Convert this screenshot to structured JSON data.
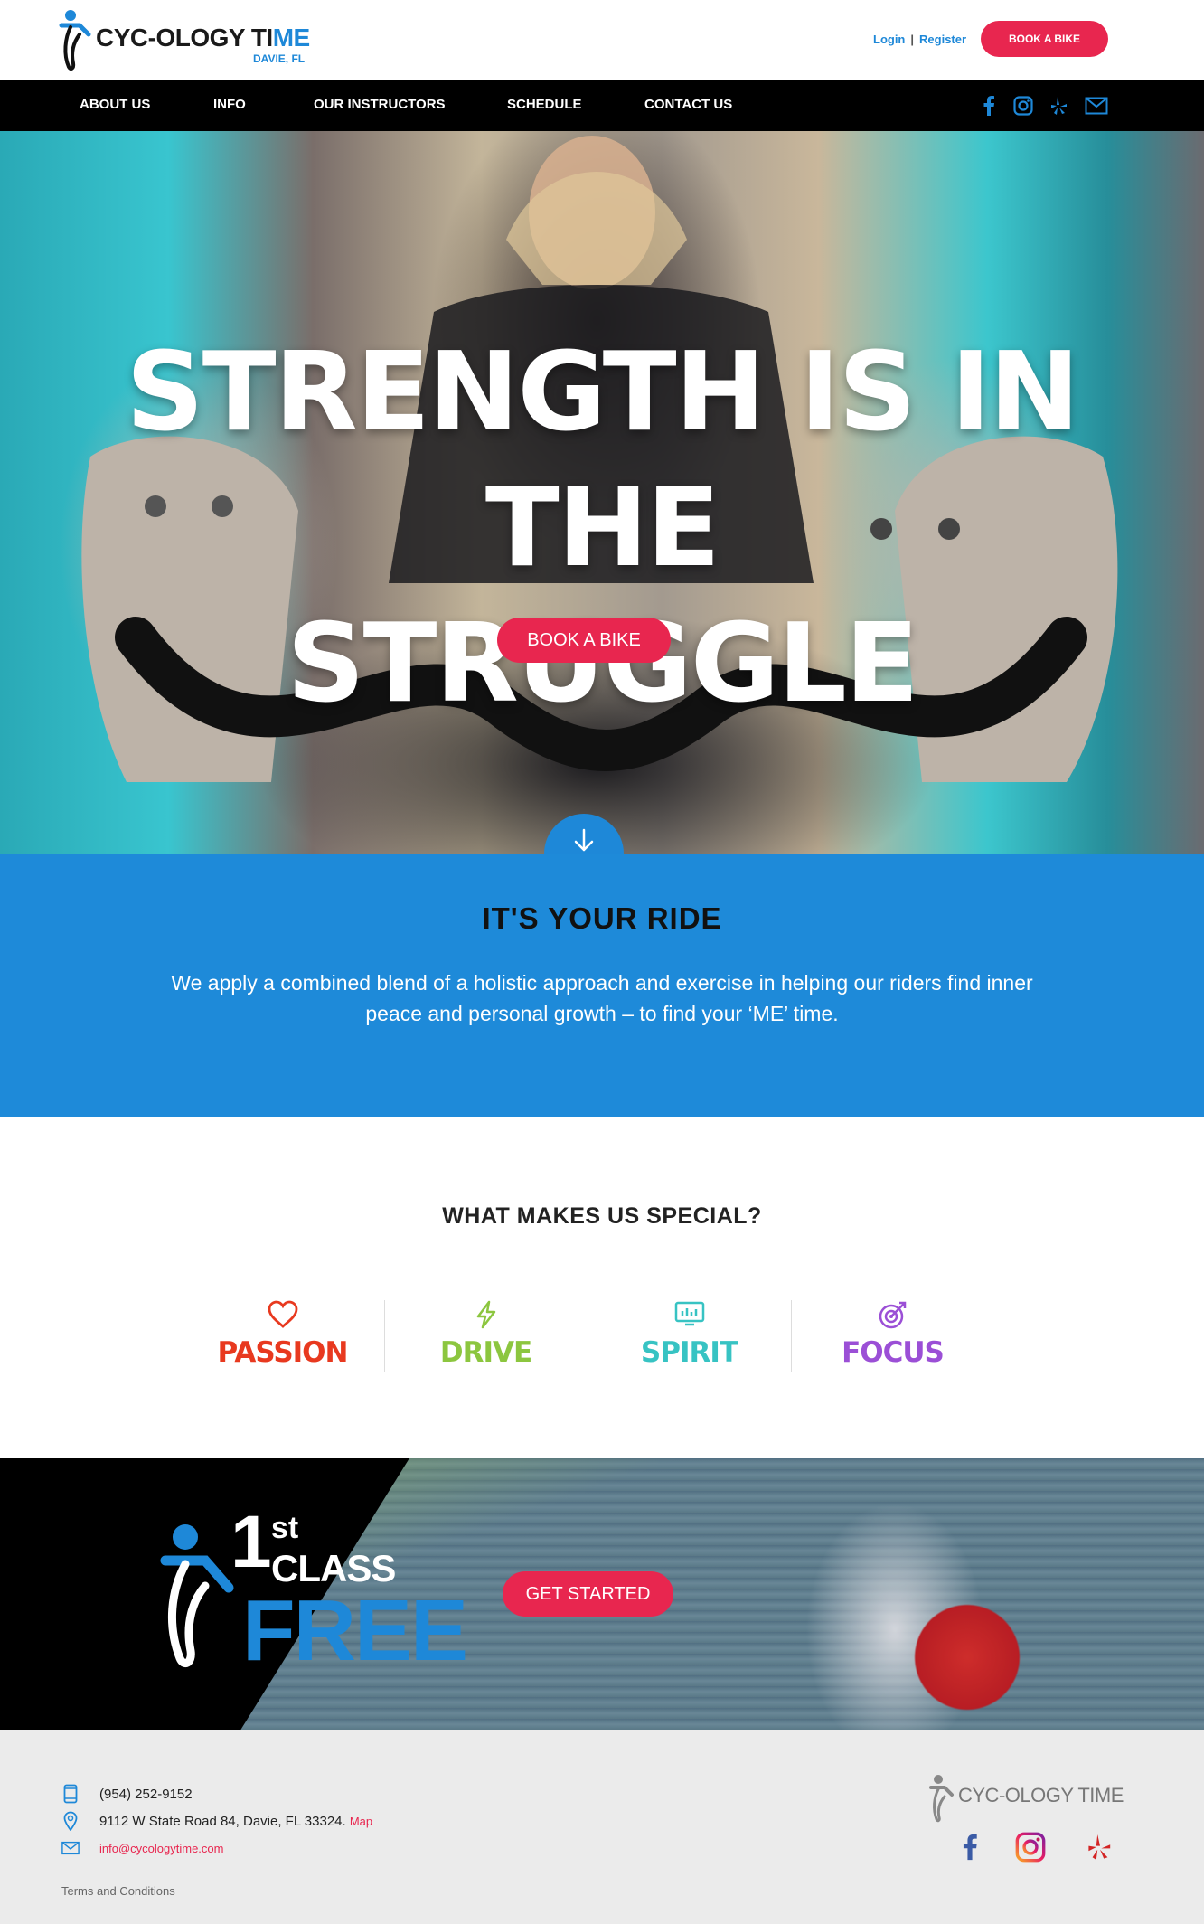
{
  "header": {
    "logo_text_main": "CYC-OLOGY TI",
    "logo_text_accent": "ME",
    "logo_subtitle": "DAVIE, FL",
    "login_label": "Login",
    "separator": "|",
    "register_label": "Register",
    "book_label": "BOOK A BIKE"
  },
  "nav": {
    "items": [
      "ABOUT US",
      "INFO",
      "OUR INSTRUCTORS",
      "SCHEDULE",
      "CONTACT US"
    ],
    "social_icons": [
      "facebook-icon",
      "instagram-icon",
      "yelp-icon",
      "mail-icon"
    ]
  },
  "hero": {
    "title_line1": "STRENGTH IS IN THE",
    "title_line2": "STRUGGLE",
    "button_label": "BOOK A BIKE"
  },
  "ride": {
    "heading": "IT'S YOUR RIDE",
    "body": "We apply a combined blend of a holistic approach and exercise in helping our riders find inner peace and personal growth – to find your ‘ME’ time."
  },
  "special": {
    "heading": "WHAT MAKES US SPECIAL?",
    "features": [
      {
        "label": "PASSION",
        "icon": "heart-icon",
        "color": "#e8391f"
      },
      {
        "label": "DRIVE",
        "icon": "lightning-icon",
        "color": "#8cc63f"
      },
      {
        "label": "SPIRIT",
        "icon": "equalizer-icon",
        "color": "#37c3c3"
      },
      {
        "label": "FOCUS",
        "icon": "target-icon",
        "color": "#9b4fd6"
      }
    ]
  },
  "promo": {
    "number": "1",
    "suffix": "st",
    "class_label": "CLASS",
    "free_label": "FREE",
    "button_label": "GET STARTED"
  },
  "footer": {
    "phone": "(954) 252-9152",
    "address": "9112 W State Road 84, Davie, FL 33324.",
    "map_label": "Map",
    "email": "info@cycologytime.com",
    "terms_label": "Terms and Conditions",
    "logo_text": "CYC-OLOGY TIME"
  },
  "colors": {
    "brand_blue": "#1e88d8",
    "brand_red": "#e8264f",
    "nav_bg": "#000000",
    "footer_bg": "#ebebeb"
  }
}
